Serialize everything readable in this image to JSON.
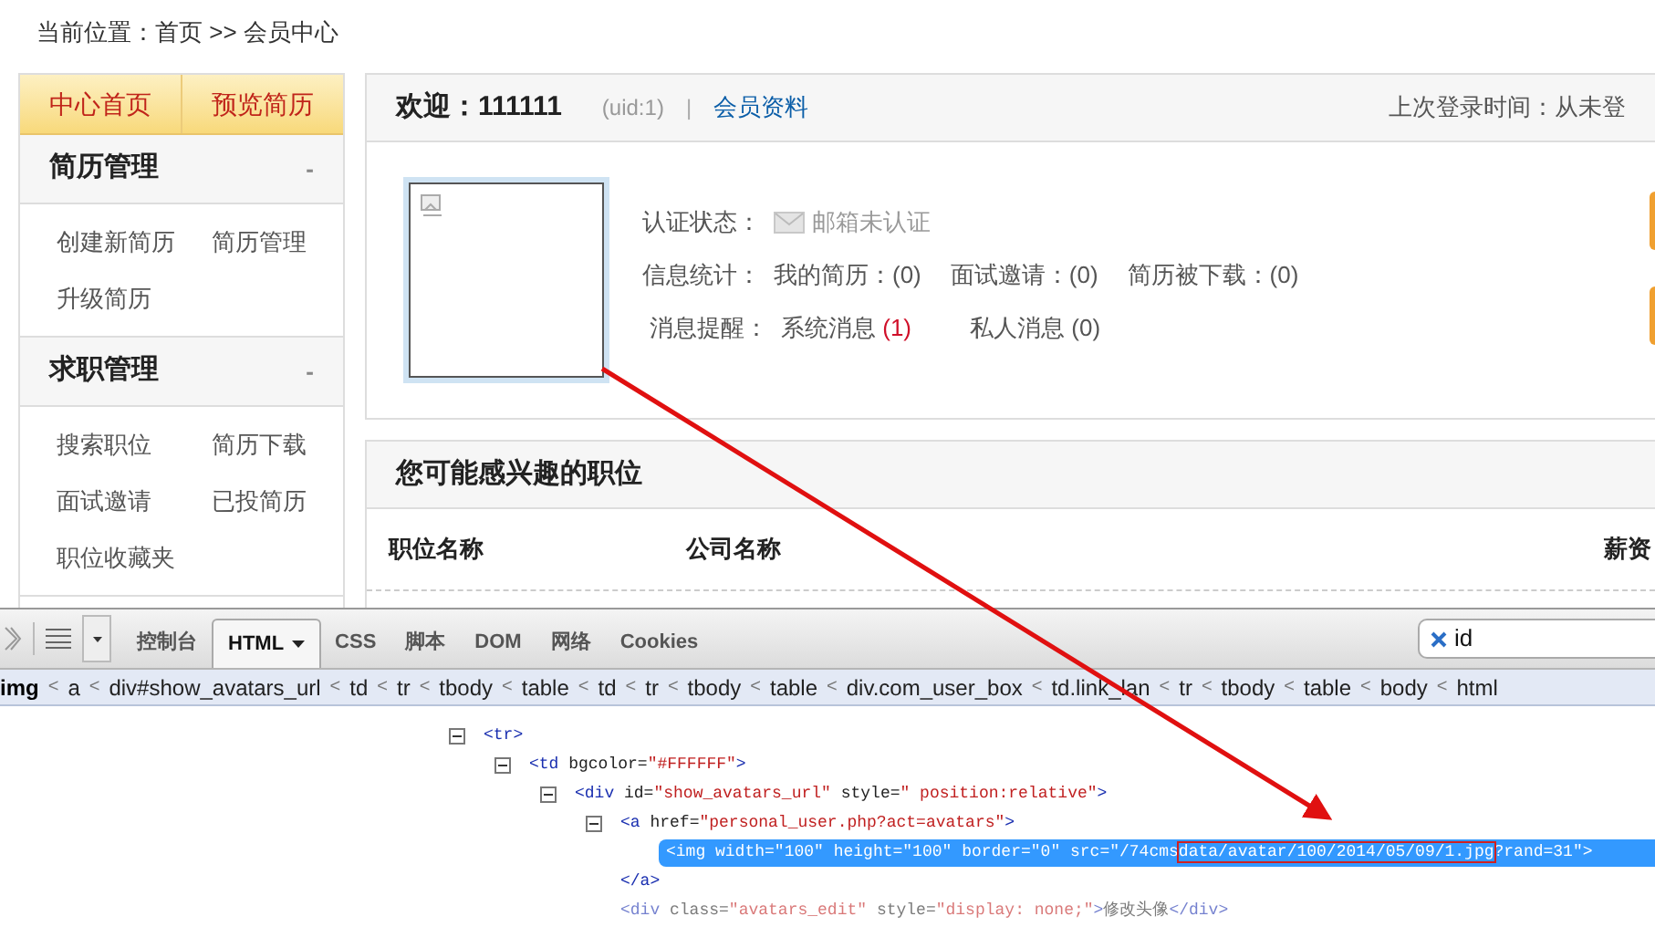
{
  "breadcrumb": "当前位置：首页 >> 会员中心",
  "sidebar": {
    "tabs": [
      "中心首页",
      "预览简历"
    ],
    "sections": [
      {
        "title": "简历管理",
        "toggle": "-",
        "links": [
          "创建新简历",
          "简历管理",
          "升级简历"
        ]
      },
      {
        "title": "求职管理",
        "toggle": "-",
        "links": [
          "搜索职位",
          "简历下载",
          "面试邀请",
          "已投简历",
          "职位收藏夹"
        ]
      }
    ]
  },
  "welcome": {
    "greeting": "欢迎：",
    "name": "111111",
    "uid": "(uid:1)",
    "separator": "|",
    "profile_link": "会员资料",
    "last_login": "上次登录时间：从未登"
  },
  "info": {
    "rows": [
      {
        "label": "认证状态：",
        "items": [
          {
            "kind": "mail",
            "text": "邮箱未认证"
          }
        ]
      },
      {
        "label": "信息统计：",
        "items": [
          {
            "kind": "count",
            "text": "我的简历：",
            "count": "(0)",
            "alert": false
          },
          {
            "kind": "count",
            "text": "面试邀请：",
            "count": "(0)",
            "alert": false
          },
          {
            "kind": "count",
            "text": "简历被下载：",
            "count": "(0)",
            "alert": false
          }
        ]
      },
      {
        "label": "消息提醒：",
        "items": [
          {
            "kind": "count",
            "text": "系统消息 ",
            "count": "(1)",
            "alert": true
          },
          {
            "kind": "count",
            "text": "私人消息 ",
            "count": "(0)",
            "alert": false
          }
        ]
      }
    ]
  },
  "jobs": {
    "title": "您可能感兴趣的职位",
    "columns": [
      "职位名称",
      "公司名称",
      "薪资"
    ]
  },
  "devtools": {
    "tabs": [
      {
        "label": "控制台",
        "selected": false,
        "dropdown": false
      },
      {
        "label": "HTML",
        "selected": true,
        "dropdown": true
      },
      {
        "label": "CSS",
        "selected": false,
        "dropdown": false
      },
      {
        "label": "脚本",
        "selected": false,
        "dropdown": false
      },
      {
        "label": "DOM",
        "selected": false,
        "dropdown": false
      },
      {
        "label": "网络",
        "selected": false,
        "dropdown": false
      },
      {
        "label": "Cookies",
        "selected": false,
        "dropdown": false
      }
    ],
    "search": {
      "value": "id"
    },
    "path": [
      {
        "label": "img",
        "current": true
      },
      {
        "sep": "<",
        "label": "a",
        "current": false
      },
      {
        "sep": "<",
        "label": "div#show_avatars_url",
        "current": false
      },
      {
        "sep": "<",
        "label": "td",
        "current": false
      },
      {
        "sep": "<",
        "label": "tr",
        "current": false
      },
      {
        "sep": "<",
        "label": "tbody",
        "current": false
      },
      {
        "sep": "<",
        "label": "table",
        "current": false
      },
      {
        "sep": "<",
        "label": "td",
        "current": false
      },
      {
        "sep": "<",
        "label": "tr",
        "current": false
      },
      {
        "sep": "<",
        "label": "tbody",
        "current": false
      },
      {
        "sep": "<",
        "label": "table",
        "current": false
      },
      {
        "sep": "<",
        "label": "div.com_user_box",
        "current": false
      },
      {
        "sep": "<",
        "label": "td.link_lan",
        "current": false
      },
      {
        "sep": "<",
        "label": "tr",
        "current": false
      },
      {
        "sep": "<",
        "label": "tbody",
        "current": false
      },
      {
        "sep": "<",
        "label": "table",
        "current": false
      },
      {
        "sep": "<",
        "label": "body",
        "current": false
      },
      {
        "sep": "<",
        "label": "html",
        "current": false
      }
    ],
    "tree": [
      {
        "kind": "branch",
        "expanded": true,
        "selected": false,
        "dimmed": false,
        "parts": [
          {
            "kind": "tag",
            "text": "<tr>"
          }
        ],
        "children": [
          {
            "kind": "branch",
            "expanded": true,
            "selected": false,
            "dimmed": false,
            "parts": [
              {
                "kind": "tag",
                "text": "<td"
              },
              {
                "kind": "attr",
                "text": " bgcolor="
              },
              {
                "kind": "value",
                "text": "\"#FFFFFF\""
              },
              {
                "kind": "tag",
                "text": ">"
              }
            ],
            "children": [
              {
                "kind": "branch",
                "expanded": true,
                "selected": false,
                "dimmed": false,
                "parts": [
                  {
                    "kind": "tag",
                    "text": "<div"
                  },
                  {
                    "kind": "attr",
                    "text": " id="
                  },
                  {
                    "kind": "value",
                    "text": "\"show_avatars_url\""
                  },
                  {
                    "kind": "attr",
                    "text": " style="
                  },
                  {
                    "kind": "value",
                    "text": "\" position:relative\""
                  },
                  {
                    "kind": "tag",
                    "text": ">"
                  }
                ],
                "children": [
                  {
                    "kind": "branch",
                    "expanded": true,
                    "selected": false,
                    "dimmed": false,
                    "parts": [
                      {
                        "kind": "tag",
                        "text": "<a"
                      },
                      {
                        "kind": "attr",
                        "text": " href="
                      },
                      {
                        "kind": "value",
                        "text": "\"personal_user.php?act=avatars\""
                      },
                      {
                        "kind": "tag",
                        "text": ">"
                      }
                    ],
                    "children": [
                      {
                        "kind": "leaf",
                        "selected": true,
                        "dimmed": false,
                        "parts": [
                          {
                            "kind": "tag",
                            "text": "<img"
                          },
                          {
                            "kind": "attr",
                            "text": " width="
                          },
                          {
                            "kind": "value",
                            "text": "\"100\""
                          },
                          {
                            "kind": "attr",
                            "text": " height="
                          },
                          {
                            "kind": "value",
                            "text": "\"100\""
                          },
                          {
                            "kind": "attr",
                            "text": " border="
                          },
                          {
                            "kind": "value",
                            "text": "\"0\""
                          },
                          {
                            "kind": "attr",
                            "text": " src="
                          },
                          {
                            "kind": "value",
                            "text": "\"/74cms"
                          },
                          {
                            "kind": "boxed",
                            "text": "data/avatar/100/2014/05/09/1.jpg"
                          },
                          {
                            "kind": "value",
                            "text": "?rand=31\""
                          },
                          {
                            "kind": "tag",
                            "text": ">"
                          }
                        ]
                      }
                    ]
                  },
                  {
                    "kind": "leaf",
                    "selected": false,
                    "dimmed": false,
                    "parts": [
                      {
                        "kind": "tag",
                        "text": "</a>"
                      }
                    ]
                  },
                  {
                    "kind": "leaf",
                    "selected": false,
                    "dimmed": true,
                    "parts": [
                      {
                        "kind": "tag",
                        "text": "<div"
                      },
                      {
                        "kind": "attr",
                        "text": " class="
                      },
                      {
                        "kind": "value",
                        "text": "\"avatars_edit\""
                      },
                      {
                        "kind": "attr",
                        "text": " style="
                      },
                      {
                        "kind": "value",
                        "text": "\"display: none;\""
                      },
                      {
                        "kind": "tag",
                        "text": ">"
                      },
                      {
                        "kind": "text",
                        "text": "修改头像"
                      },
                      {
                        "kind": "tag",
                        "text": "</div>"
                      }
                    ]
                  }
                ]
              }
            ]
          }
        ]
      }
    ]
  }
}
